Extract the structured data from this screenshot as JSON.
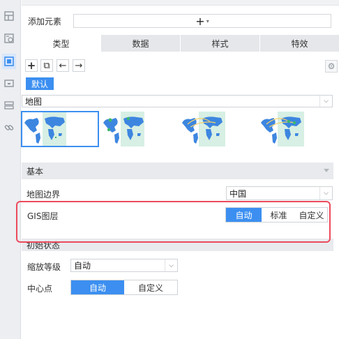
{
  "sidebar": {
    "icons": [
      {
        "name": "layout-icon"
      },
      {
        "name": "widget-icon"
      },
      {
        "name": "component-icon",
        "active": true
      },
      {
        "name": "panel-icon"
      },
      {
        "name": "layers-icon"
      },
      {
        "name": "link-icon"
      }
    ]
  },
  "add_element": {
    "label": "添加元素",
    "button_glyph": "+",
    "caret": "▾"
  },
  "tabs": [
    {
      "label": "类型",
      "active": true
    },
    {
      "label": "数据",
      "active": false
    },
    {
      "label": "样式",
      "active": false
    },
    {
      "label": "特效",
      "active": false
    }
  ],
  "toolbar": {
    "add_glyph": "+",
    "copy_glyph": "⧉",
    "back_glyph": "←",
    "forward_glyph": "→",
    "gear_glyph": "⚙"
  },
  "default_label": "默认",
  "chart_type": {
    "value": "地图",
    "arrow": "⌵"
  },
  "map_thumbnails": [
    {
      "variant": "plain",
      "selected": true
    },
    {
      "variant": "markers",
      "selected": false
    },
    {
      "variant": "flow",
      "selected": false
    },
    {
      "variant": "flow-markers",
      "selected": false
    }
  ],
  "basic_section": {
    "title": "基本"
  },
  "map_boundary": {
    "label": "地图边界",
    "value": "中国",
    "arrow": "⌵"
  },
  "gis_layer": {
    "label": "GIS图层",
    "options": [
      "自动",
      "标准",
      "自定义"
    ],
    "selected": "自动"
  },
  "initial_state": {
    "title": "初始状态"
  },
  "zoom_level": {
    "label": "缩放等级",
    "value": "自动",
    "arrow": "⌵"
  },
  "center_point": {
    "label": "中心点",
    "options": [
      "自动",
      "自定义"
    ],
    "selected": "自动"
  },
  "colors": {
    "accent": "#3c8ff0",
    "highlight": "#ec4b5d",
    "map_land": "#3d86e0",
    "map_marker": "#3db86e",
    "map_bg": "#d7efe4"
  }
}
